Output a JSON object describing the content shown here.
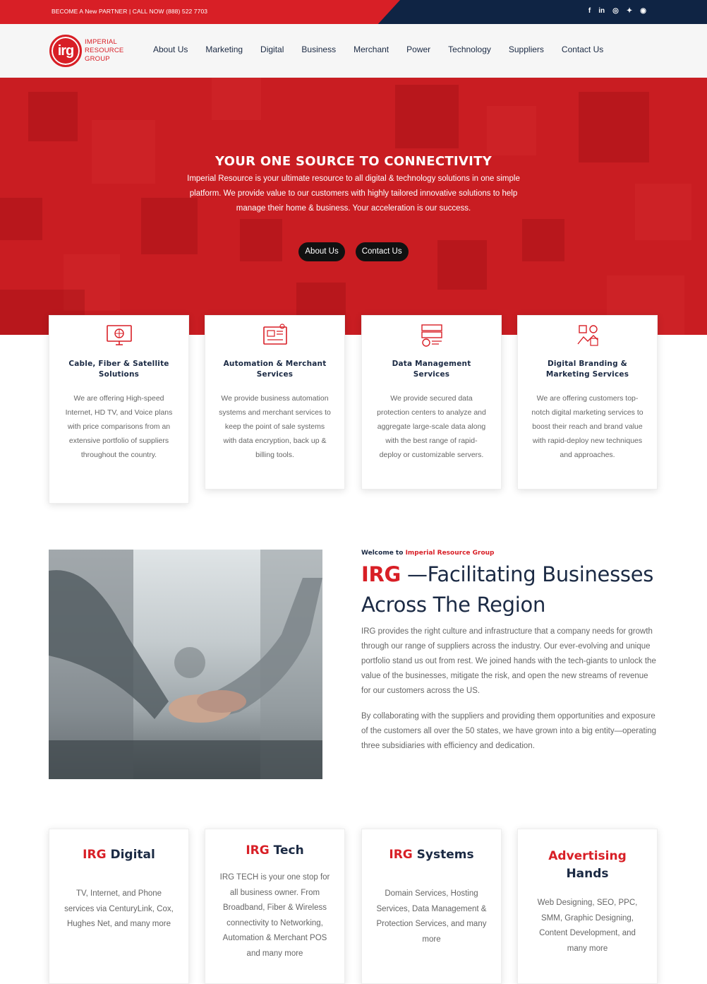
{
  "topbar": {
    "cta_text": "BECOME A New PARTNER  |  CALL NOW (888) 522 7703",
    "social": [
      "f",
      "in",
      "◎",
      "✦",
      "◉"
    ]
  },
  "logo": {
    "mark": "irg",
    "line1": "IMPERIAL",
    "line2": "RESOURCE",
    "line3": "GROUP"
  },
  "nav": [
    "About Us",
    "Marketing",
    "Digital",
    "Business",
    "Merchant",
    "Power",
    "Technology",
    "Suppliers",
    "Contact Us"
  ],
  "hero": {
    "title": "YOUR ONE SOURCE TO CONNECTIVITY",
    "description": "Imperial Resource is your ultimate resource to all digital & technology solutions in one simple platform. We provide value to our customers with highly tailored innovative solutions to help manage their home & business. Your acceleration is our success.",
    "btn_about": "About Us",
    "btn_contact": "Contact Us"
  },
  "services": [
    {
      "icon": "monitor-globe-icon",
      "title": "Cable, Fiber & Satellite Solutions",
      "text": "We are offering High-speed Internet, HD TV, and Voice plans with price comparisons from an extensive portfolio of suppliers throughout the country."
    },
    {
      "icon": "automation-icon",
      "title": "Automation & Merchant Services",
      "text": "We provide business automation systems and merchant services to keep the point of sale systems with data encryption, back up & billing tools."
    },
    {
      "icon": "server-gear-icon",
      "title": "Data Management Services",
      "text": "We provide secured data protection centers to analyze and aggregate large-scale data along with the best range of rapid-deploy or customizable servers."
    },
    {
      "icon": "branding-icon",
      "title": "Digital Branding & Marketing Services",
      "text": "We are offering customers top-notch digital marketing services to boost their reach and brand value with rapid-deploy new techniques and approaches."
    }
  ],
  "welcome": {
    "kicker_prefix": "Welcome to ",
    "kicker_name": "Imperial Resource Group",
    "head_red": "IRG",
    "head_rest": " —Facilitating Businesses Across The Region",
    "p1": "IRG provides the right culture and infrastructure that a company needs for growth through our range of suppliers across the industry. Our ever-evolving and unique portfolio stand us out from rest. We joined hands with the tech-giants to unlock the value of the businesses, mitigate the risk, and open the new streams of revenue for our customers across the US.",
    "p2": "By collaborating with the suppliers and providing them opportunities and exposure of the customers all over the 50 states, we have grown into a big entity—operating three subsidiaries with efficiency and dedication."
  },
  "subsidiaries": [
    {
      "red": "IRG",
      "rest": " Digital",
      "text": "TV, Internet, and Phone services via CenturyLink, Cox, Hughes Net, and many more"
    },
    {
      "red": "IRG",
      "rest": " Tech",
      "text": "IRG TECH is your one stop for all business owner. From Broadband, Fiber & Wireless connectivity to Networking, Automation & Merchant POS and many more"
    },
    {
      "red": "IRG",
      "rest": " Systems",
      "text": "Domain Services, Hosting Services, Data Management & Protection Services, and many more"
    },
    {
      "red": "Advertising",
      "rest": "Hands",
      "text": "Web Designing, SEO, PPC, SMM, Graphic Designing, Content Development, and many more"
    }
  ],
  "colors": {
    "brand_red": "#d81f26",
    "navy": "#0f2444",
    "hero_red": "#c91d22"
  }
}
